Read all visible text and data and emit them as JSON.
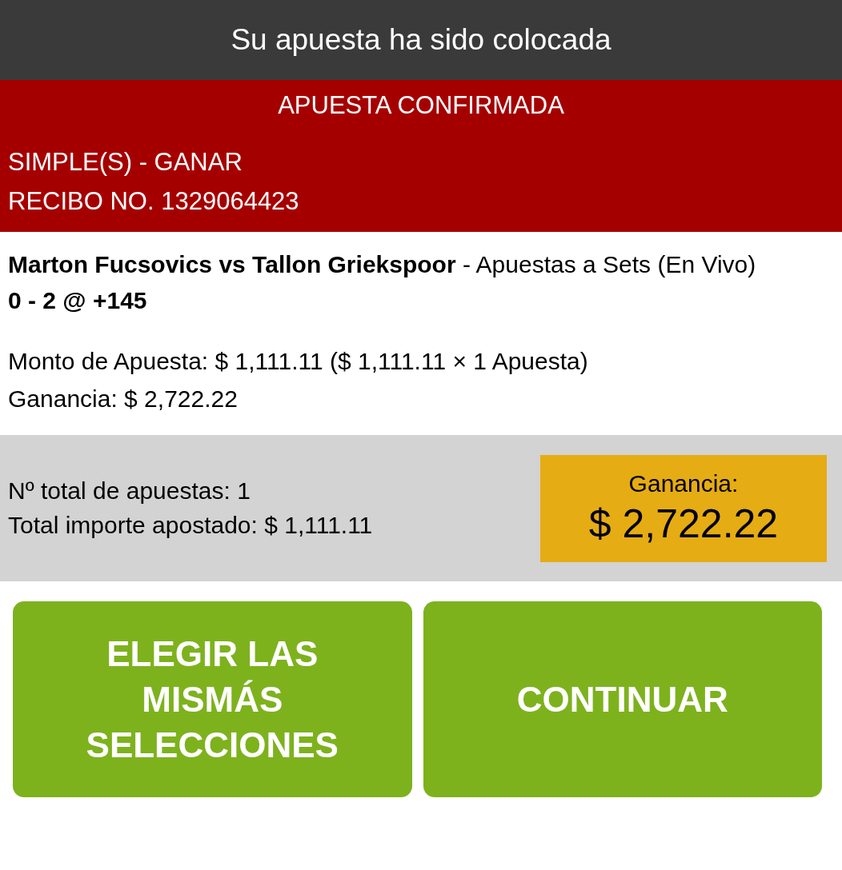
{
  "header": {
    "title": "Su apuesta ha sido colocada"
  },
  "confirmation": {
    "heading": "APUESTA CONFIRMADA",
    "bet_type": "SIMPLE(S) - GANAR",
    "receipt": "RECIBO NO. 1329064423"
  },
  "bet": {
    "description": "**Marton Fucsovics vs Tallon Griekspoor** - Apuestas a Sets (En Vivo)",
    "selection": "0 - 2 @ +145",
    "stake": "Monto de Apuesta: $ 1,111.11 ($ 1,111.11 × 1 Apuesta)",
    "winnings": "Ganancia: $ 2,722.22"
  },
  "summary": {
    "total_bets": "Nº total de apuestas: 1",
    "total_staked": "Total importe apostado: $ 1,111.11",
    "payout_label": "Ganancia:",
    "payout_value": "$ 2,722.22"
  },
  "buttons": [
    {
      "label": "ELEGIR LAS MISMÁS SELECCIONES"
    },
    {
      "label": "CONTINUAR"
    }
  ]
}
